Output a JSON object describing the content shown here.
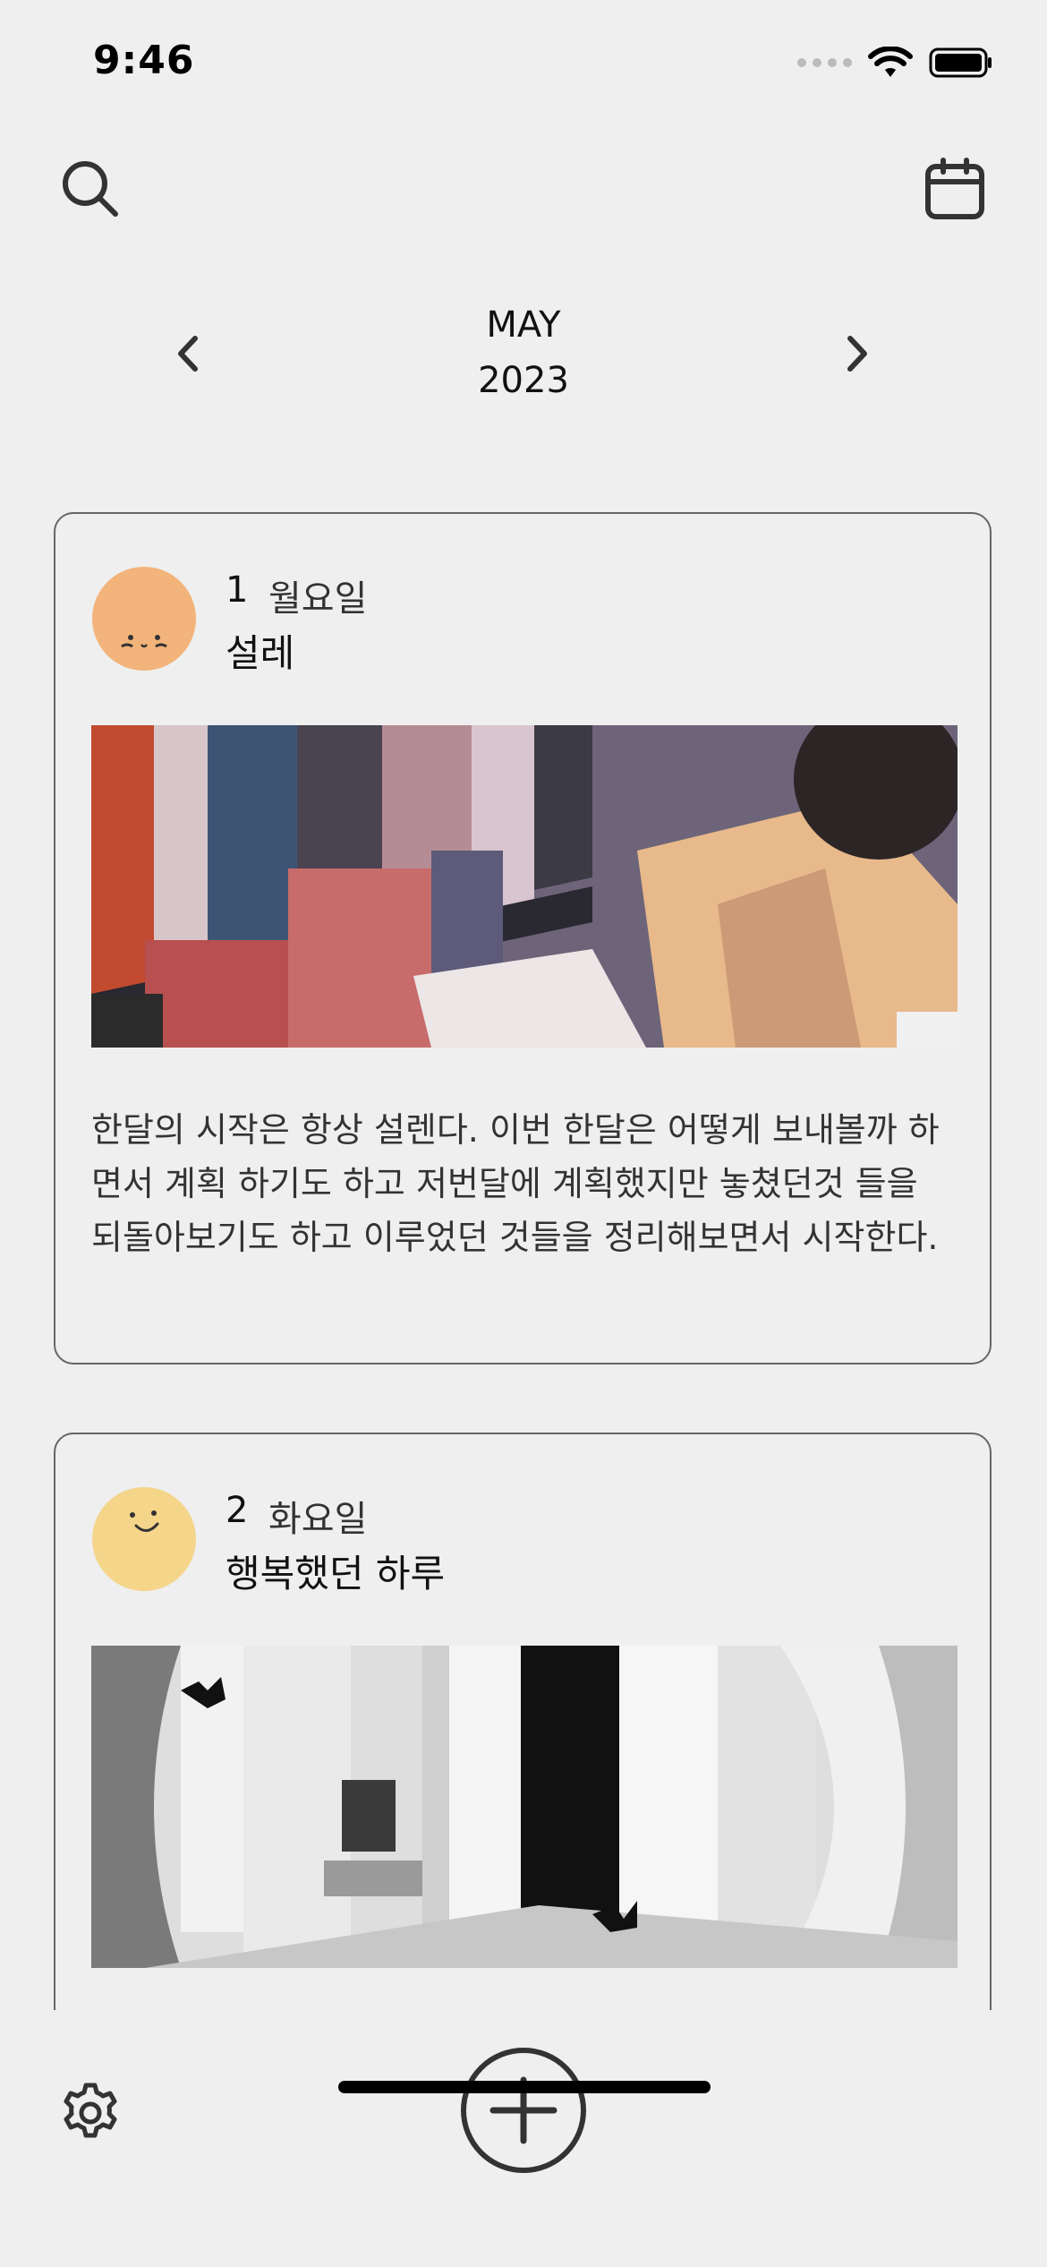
{
  "status_bar": {
    "time": "9:46"
  },
  "header": {
    "month": "MAY",
    "year": "2023"
  },
  "entries": [
    {
      "day": "1",
      "weekday": "월요일",
      "title": "설레",
      "body": "한달의 시작은 항상 설렌다. 이번 한달은 어떻게 보내볼까 하면서 계획 하기도 하고 저번달에 계획했지만 놓쳤던것 들을 되돌아보기도 하고 이루었던 것들을 정리해보면서 시작한다.",
      "mood_color": "#f2b47a"
    },
    {
      "day": "2",
      "weekday": "화요일",
      "title": "행복했던 하루",
      "body": "",
      "mood_color": "#f4d58a"
    }
  ],
  "icons": {
    "search": "search-icon",
    "calendar": "calendar-icon",
    "prev": "chevron-left-icon",
    "next": "chevron-right-icon",
    "settings": "gear-icon",
    "add": "plus-circle-icon"
  }
}
